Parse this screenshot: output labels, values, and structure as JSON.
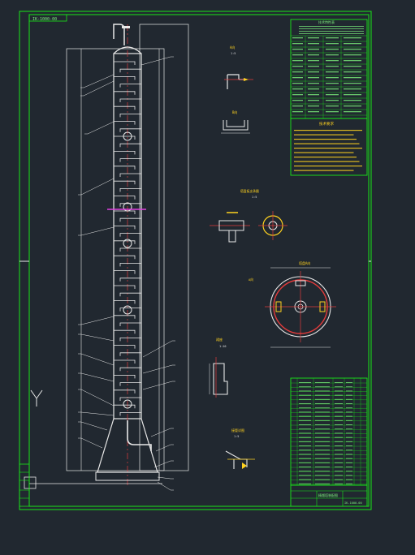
{
  "colors": {
    "background": "#212830",
    "frame": "#19e619",
    "line_white": "#e8e8e8",
    "hatch_red": "#e23b3b",
    "center_magenta": "#e040e0",
    "cyan": "#4fd6e6",
    "text_green": "#7cf07c",
    "yellow": "#ffd21f"
  },
  "drawing": {
    "title_stamp": "IK-1000-00",
    "tech_req_title": "技术要求",
    "tech_specs_label": "技术特性表",
    "detail_a_label": "A向",
    "detail_b_label": "B向",
    "detail_section_label": "塔盘板支承圈",
    "detail_plan_label": "塔盘A向",
    "detail_lower_label": "裙座",
    "detail_bottom_label": "接管详图",
    "scale_1": "1:5",
    "scale_2": "1:10",
    "scale_3": "1:5",
    "bom_title": "明细表",
    "title_block_name": "精馏塔装配图",
    "title_block_no": "IK-1000-00"
  },
  "icons": {
    "ucs": "ucs-y-icon"
  }
}
